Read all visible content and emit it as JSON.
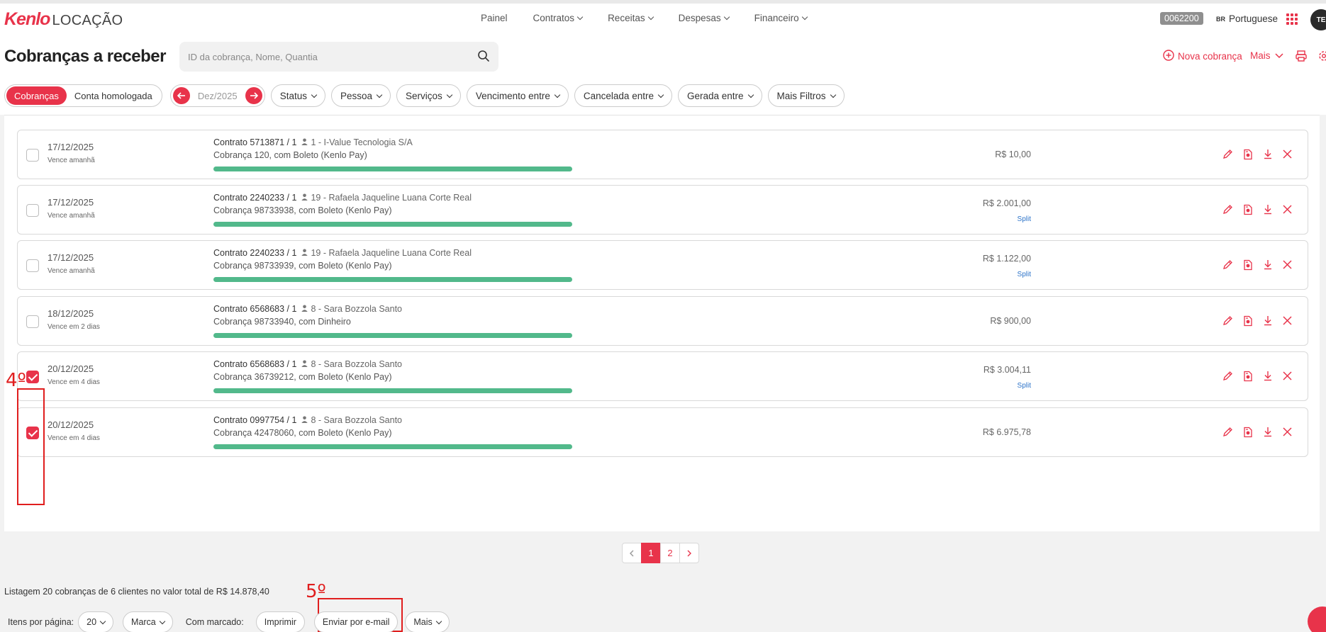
{
  "nav": {
    "brand": "Kenlo",
    "product": "LOCAÇÃO",
    "items": [
      {
        "label": "Painel",
        "dropdown": false
      },
      {
        "label": "Contratos",
        "dropdown": true
      },
      {
        "label": "Receitas",
        "dropdown": true
      },
      {
        "label": "Despesas",
        "dropdown": true
      },
      {
        "label": "Financeiro",
        "dropdown": true
      }
    ],
    "account_code": "0062200",
    "language_flag": "BR",
    "language": "Portuguese",
    "avatar_initials": "TE"
  },
  "header": {
    "title": "Cobranças a receber",
    "search_placeholder": "ID da cobrança, Nome, Quantia",
    "new_charge": "Nova cobrança",
    "more": "Mais"
  },
  "filters": {
    "toggle": [
      "Cobranças",
      "Conta homologada"
    ],
    "toggle_active": "Cobranças",
    "month": "Dez/2025",
    "chips": [
      "Status",
      "Pessoa",
      "Serviços",
      "Vencimento entre",
      "Cancelada entre",
      "Gerada entre",
      "Mais Filtros"
    ]
  },
  "rows": [
    {
      "date": "17/12/2025",
      "due": "Vence amanhã",
      "contract": "Contrato 5713871 / 1",
      "person": "1 - I-Value Tecnologia S/A",
      "charge": "Cobrança 120, com Boleto (Kenlo Pay)",
      "amount": "R$ 10,00",
      "split": "",
      "checked": false
    },
    {
      "date": "17/12/2025",
      "due": "Vence amanhã",
      "contract": "Contrato 2240233 / 1",
      "person": "19 - Rafaela Jaqueline Luana Corte Real",
      "charge": "Cobrança 98733938, com Boleto (Kenlo Pay)",
      "amount": "R$ 2.001,00",
      "split": "Split",
      "checked": false
    },
    {
      "date": "17/12/2025",
      "due": "Vence amanhã",
      "contract": "Contrato 2240233 / 1",
      "person": "19 - Rafaela Jaqueline Luana Corte Real",
      "charge": "Cobrança 98733939, com Boleto (Kenlo Pay)",
      "amount": "R$ 1.122,00",
      "split": "Split",
      "checked": false
    },
    {
      "date": "18/12/2025",
      "due": "Vence em 2 dias",
      "contract": "Contrato 6568683 / 1",
      "person": "8 - Sara Bozzola Santo",
      "charge": "Cobrança 98733940, com Dinheiro",
      "amount": "R$ 900,00",
      "split": "",
      "checked": false
    },
    {
      "date": "20/12/2025",
      "due": "Vence em 4 dias",
      "contract": "Contrato 6568683 / 1",
      "person": "8 - Sara Bozzola Santo",
      "charge": "Cobrança 36739212, com Boleto (Kenlo Pay)",
      "amount": "R$ 3.004,11",
      "split": "Split",
      "checked": true
    },
    {
      "date": "20/12/2025",
      "due": "Vence em 4 dias",
      "contract": "Contrato 0997754 / 1",
      "person": "8 - Sara Bozzola Santo",
      "charge": "Cobrança 42478060, com Boleto (Kenlo Pay)",
      "amount": "R$ 6.975,78",
      "split": "",
      "checked": true
    }
  ],
  "annotations": {
    "step4": "4º",
    "step5": "5º"
  },
  "pagination": {
    "pages": [
      "1",
      "2"
    ],
    "current": "1"
  },
  "footer": {
    "summary": "Listagem 20 cobranças de 6 clientes no valor total de R$ 14.878,40",
    "items_per_page_label": "Itens por página:",
    "items_per_page": "20",
    "marca": "Marca",
    "with_marked_label": "Com marcado:",
    "print": "Imprimir",
    "send_email": "Enviar por e-mail",
    "more": "Mais"
  },
  "colors": {
    "accent": "#e8334a",
    "progress": "#52b98b",
    "split": "#2d74c9",
    "annotation": "#e01e1e"
  }
}
